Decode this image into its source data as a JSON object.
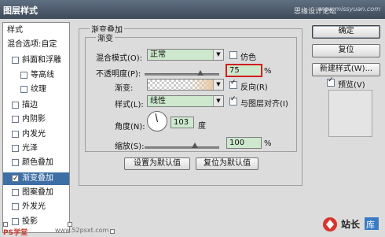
{
  "window": {
    "title": "图层样式",
    "watermark": "思缘设计论坛",
    "watermark_url": "www.missyuan.com"
  },
  "left_panel": {
    "items": [
      {
        "label": "样式",
        "has_checkbox": false,
        "checked": false,
        "indent": false,
        "selected": false
      },
      {
        "label": "混合选项:自定",
        "has_checkbox": false,
        "checked": false,
        "indent": false,
        "selected": false
      },
      {
        "label": "斜面和浮雕",
        "has_checkbox": true,
        "checked": false,
        "indent": false,
        "selected": false
      },
      {
        "label": "等高线",
        "has_checkbox": true,
        "checked": false,
        "indent": true,
        "selected": false
      },
      {
        "label": "纹理",
        "has_checkbox": true,
        "checked": false,
        "indent": true,
        "selected": false
      },
      {
        "label": "描边",
        "has_checkbox": true,
        "checked": false,
        "indent": false,
        "selected": false
      },
      {
        "label": "内阴影",
        "has_checkbox": true,
        "checked": false,
        "indent": false,
        "selected": false
      },
      {
        "label": "内发光",
        "has_checkbox": true,
        "checked": false,
        "indent": false,
        "selected": false
      },
      {
        "label": "光泽",
        "has_checkbox": true,
        "checked": false,
        "indent": false,
        "selected": false
      },
      {
        "label": "颜色叠加",
        "has_checkbox": true,
        "checked": false,
        "indent": false,
        "selected": false
      },
      {
        "label": "渐变叠加",
        "has_checkbox": true,
        "checked": true,
        "indent": false,
        "selected": true
      },
      {
        "label": "图案叠加",
        "has_checkbox": true,
        "checked": false,
        "indent": false,
        "selected": false
      },
      {
        "label": "外发光",
        "has_checkbox": true,
        "checked": false,
        "indent": false,
        "selected": false
      },
      {
        "label": "投影",
        "has_checkbox": true,
        "checked": false,
        "indent": false,
        "selected": false
      }
    ]
  },
  "section": {
    "title": "渐变叠加",
    "subtitle": "渐变"
  },
  "blend_mode": {
    "label": "混合模式(O):",
    "value": "正常"
  },
  "dither": {
    "label": "仿色",
    "checked": false
  },
  "opacity": {
    "label": "不透明度(P):",
    "value": "75",
    "unit": "%",
    "level": 0.75
  },
  "gradient": {
    "label": "渐变:"
  },
  "reverse": {
    "label": "反向(R)",
    "checked": true
  },
  "style": {
    "label": "样式(L):",
    "value": "线性"
  },
  "align_layer": {
    "label": "与图层对齐(I)",
    "checked": true
  },
  "angle": {
    "label": "角度(N):",
    "value": "103",
    "unit": "度"
  },
  "scale": {
    "label": "缩放(S):",
    "value": "100",
    "unit": "%",
    "level": 0.67
  },
  "buttons": {
    "set_default": "设置为默认值",
    "reset_default": "复位为默认值",
    "ok": "确定",
    "reset": "复位",
    "new_style": "新建样式(W)...",
    "preview_label": "预览(V)"
  },
  "preview": {
    "checked": true
  },
  "footer": {
    "ps_mark": "PS学堂",
    "ps_url": "www.52psxt.com",
    "logo_text": "站长",
    "logo_text2": "库"
  }
}
